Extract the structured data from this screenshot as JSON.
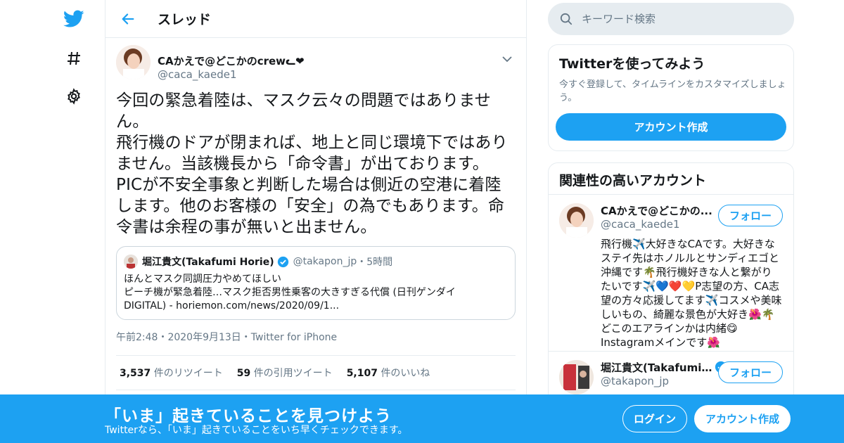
{
  "colors": {
    "brand": "#1da1f2",
    "text": "#14171a",
    "muted": "#657786",
    "border": "#e6ecf0",
    "banner": "#1da1f2"
  },
  "nav": {
    "icons": [
      "twitter-bird-icon",
      "hashtag-icon",
      "gear-icon"
    ]
  },
  "header": {
    "title": "スレッド"
  },
  "tweet": {
    "author_name": "CAかえで@どこかのcrewᓚ❤",
    "author_handle": "@caca_kaede1",
    "text": "今回の緊急着陸は、マスク云々の問題ではありませ\nん。\n飛行機のドアが閉まれば、地上と同じ環境下ではあり\nません。当該機長から「命令書」が出ております。\nPICが不安全事象と判断した場合は側近の空港に着陸\nします。他のお客様の「安全」の為でもあります。命\n令書は余程の事が無いと出ません。",
    "timestamp": "午前2:48・2020年9月13日・Twitter for iPhone",
    "quote": {
      "name": "堀江貴文(Takafumi Horie)",
      "handle": "@takapon_jp",
      "time": "・5時間",
      "text": "ほんとマスク同調圧力やめてほしい\nピーチ機が緊急着陸…マスク拒否男性乗客の大きすぎる代償 (日刊ゲンダイ\nDIGITAL) - horiemon.com/news/2020/09/1..."
    },
    "stats": [
      {
        "count": "3,537",
        "label": "件のリツイート"
      },
      {
        "count": "59",
        "label": "件の引用ツイート"
      },
      {
        "count": "5,107",
        "label": "件のいいね"
      }
    ]
  },
  "search": {
    "placeholder": "キーワード検索"
  },
  "signup_card": {
    "title": "Twitterを使ってみよう",
    "subtitle": "今すぐ登録して、タイムラインをカスタマイズしましょう。",
    "button": "アカウント作成"
  },
  "related": {
    "title": "関連性の高いアカウント",
    "accounts": [
      {
        "name": "CAかえで@どこかの...",
        "handle": "@caca_kaede1",
        "follow": "フォロー",
        "bio": "飛行機✈️大好きなCAです。大好きなステイ先はホノルルとサンディエゴと沖縄です🌴飛行機好きな人と繋がりたいです✈️💙❤️💛P志望の方、CA志望の方々応援してます✈️コスメや美味しいもの、綺麗な景色が大好き🌺🌴どこのエアラインかは内緒😋Instagramメインです🌺"
      },
      {
        "name": "堀江貴文(Takafumi...",
        "handle": "@takapon_jp",
        "follow": "フォロー",
        "bio": ""
      }
    ]
  },
  "banner": {
    "title": "「いま」起きていることを見つけよう",
    "subtitle": "Twitterなら、「いま」起きていることをいち早くチェックできます。",
    "login": "ログイン",
    "signup": "アカウント作成"
  }
}
